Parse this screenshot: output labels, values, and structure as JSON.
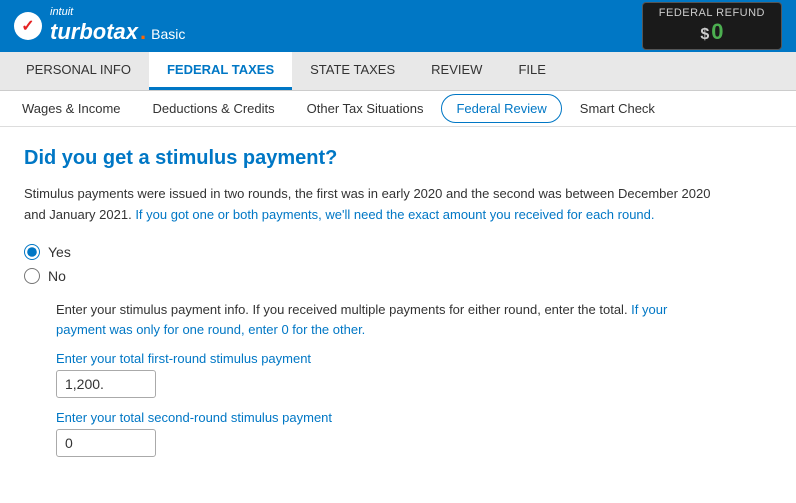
{
  "header": {
    "logo_name": "turbotax",
    "logo_dot": ".",
    "logo_basic": "Basic",
    "refund_label": "Federal Refund",
    "refund_currency": "$",
    "refund_amount": "0"
  },
  "nav": {
    "tabs": [
      {
        "label": "PERSONAL INFO",
        "active": false
      },
      {
        "label": "FEDERAL TAXES",
        "active": true
      },
      {
        "label": "STATE TAXES",
        "active": false
      },
      {
        "label": "REVIEW",
        "active": false
      },
      {
        "label": "FILE",
        "active": false
      }
    ],
    "sub_items": [
      {
        "label": "Wages & Income",
        "active": false
      },
      {
        "label": "Deductions & Credits",
        "active": false
      },
      {
        "label": "Other Tax Situations",
        "active": false
      },
      {
        "label": "Federal Review",
        "active": true
      },
      {
        "label": "Smart Check",
        "active": false
      }
    ]
  },
  "content": {
    "question_title": "Did you get a stimulus payment?",
    "intro_paragraph_normal1": "Stimulus payments were issued in two rounds, the first was in early 2020 and the second was between December 2020 and January 2021.",
    "intro_paragraph_highlight": " If you got one or both payments, we'll need the exact amount you received for each round.",
    "radio_yes": "Yes",
    "radio_no": "No",
    "detail_normal": "Enter your stimulus payment info. If you received multiple payments for either round, enter the total.",
    "detail_highlight": " If your payment was only for one round, enter 0 for the other.",
    "field_label_first": "Enter your total first-round stimulus payment",
    "field_value_first": "1,200.",
    "field_label_second": "Enter your total second-round stimulus payment",
    "field_value_second": "0"
  }
}
